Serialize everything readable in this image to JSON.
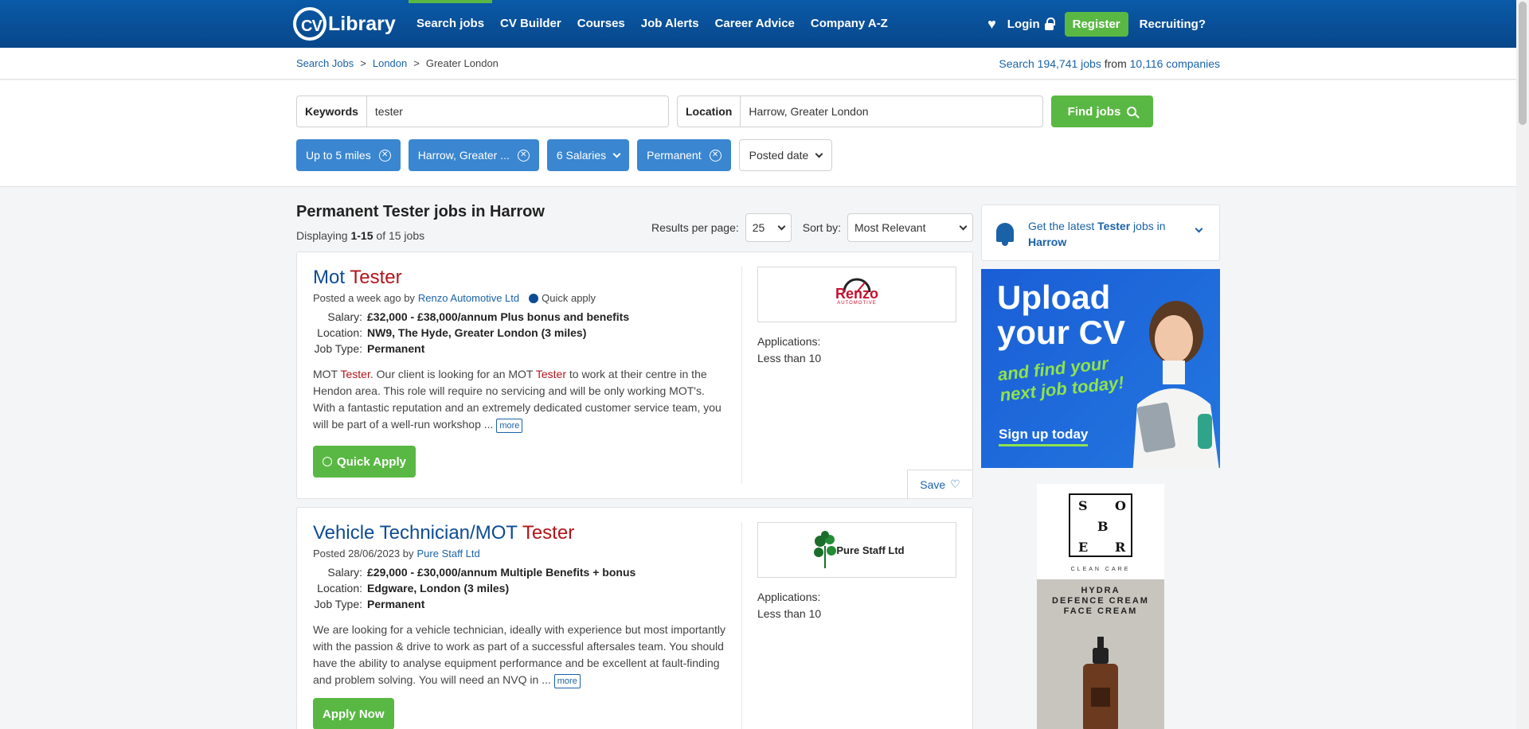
{
  "nav": {
    "logo_cv": "CV",
    "logo_text": "Library",
    "links": [
      "Search jobs",
      "CV Builder",
      "Courses",
      "Job Alerts",
      "Career Advice",
      "Company A-Z"
    ],
    "login": "Login",
    "register": "Register",
    "recruiting": "Recruiting?"
  },
  "breadcrumb": {
    "items": [
      "Search Jobs",
      "London",
      "Greater London"
    ],
    "sep": ">",
    "stats_prefix": "Search",
    "jobs_count": "194,741 jobs",
    "stats_mid": "from",
    "companies_count": "10,116 companies"
  },
  "search": {
    "keywords_label": "Keywords",
    "keywords_value": "tester",
    "location_label": "Location",
    "location_value": "Harrow, Greater London",
    "find_label": "Find jobs"
  },
  "filters": {
    "distance": "Up to 5 miles",
    "location": "Harrow, Greater ...",
    "salaries": "6 Salaries",
    "type": "Permanent",
    "posted": "Posted date"
  },
  "results": {
    "title": "Permanent Tester jobs in Harrow",
    "display_prefix": "Displaying",
    "display_range": "1-15",
    "display_suffix": "of 15 jobs",
    "per_page_label": "Results per page:",
    "per_page_value": "25",
    "sort_label": "Sort by:",
    "sort_value": "Most Relevant"
  },
  "jobs": [
    {
      "title_a": "Mot ",
      "title_b": "Tester",
      "posted": "Posted a week ago by",
      "company": "Renzo Automotive Ltd",
      "quick_apply_tag": "Quick apply",
      "salary_label": "Salary:",
      "salary": "£32,000 - £38,000/annum Plus bonus and benefits",
      "location_label": "Location:",
      "location": "NW9, The Hyde, Greater London (3 miles)",
      "type_label": "Job Type:",
      "type": "Permanent",
      "desc_1": "MOT ",
      "desc_hl1": "Tester",
      "desc_2": ". Our client is looking for an MOT ",
      "desc_hl2": "Tester",
      "desc_3": " to work at their centre in the Hendon area. This role will require no servicing and will be only working MOT's. With a fantastic reputation and an extremely dedicated customer service team, you will be part of a well-run workshop ... ",
      "more": "more",
      "apply": "Quick Apply",
      "logo_main": "Renzo",
      "logo_sub": "AUTOMOTIVE",
      "apps_label": "Applications:",
      "apps_value": "Less than 10",
      "save": "Save"
    },
    {
      "title_a": "Vehicle Technician/MOT ",
      "title_b": "Tester",
      "posted": "Posted 28/06/2023 by",
      "company": "Pure Staff Ltd",
      "salary_label": "Salary:",
      "salary": "£29,000 - £30,000/annum Multiple Benefits + bonus",
      "location_label": "Location:",
      "location": "Edgware, London (3 miles)",
      "type_label": "Job Type:",
      "type": "Permanent",
      "desc": "We are looking for a vehicle technician, ideally with experience but most importantly with the passion & drive to work as part of a successful aftersales team. You should have the ability to analyse equipment performance and be excellent at fault-finding and problem solving. You will need an NVQ in ... ",
      "more": "more",
      "apply": "Apply Now",
      "logo_main": "Pure Staff Ltd",
      "apps_label": "Applications:",
      "apps_value": "Less than 10"
    }
  ],
  "alert": {
    "prefix": "Get the latest",
    "keyword": "Tester",
    "mid": "jobs in",
    "location": "Harrow"
  },
  "ad_cv": {
    "line1": "Upload",
    "line2": "your CV",
    "sub1": "and find your",
    "sub2": "next job today!",
    "cta": "Sign up today"
  },
  "ad_sober": {
    "letters": [
      "S",
      "O",
      "B",
      "E",
      "R"
    ],
    "brand_sub": "CLEAN CARE",
    "product_1": "HYDRA",
    "product_2": "DEFENCE CREAM",
    "product_3": "FACE CREAM"
  },
  "colors": {
    "nav_blue": "#08478a",
    "accent_green": "#59b843",
    "chip_blue": "#3a86d0",
    "link_blue": "#1a62a8",
    "highlight_red": "#b3151b"
  }
}
